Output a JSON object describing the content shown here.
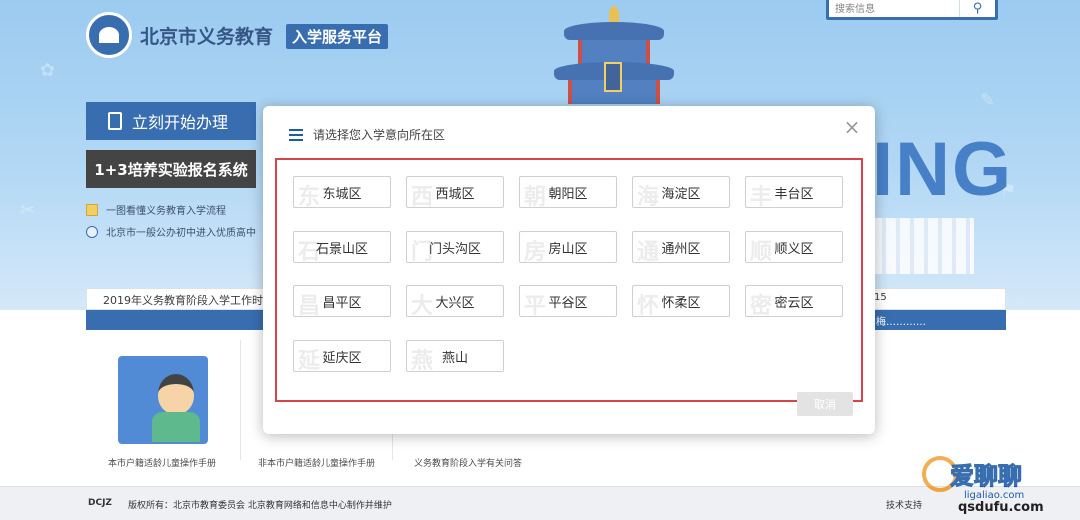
{
  "header": {
    "site_title": "北京市义务教育",
    "site_badge": "入学服务平台",
    "search_placeholder": "搜索信息"
  },
  "hero": {
    "big_letters": "ING",
    "temple_plaque": "祈年殿"
  },
  "left": {
    "start_label": "立刻开始办理",
    "reg_label": "1+3培养实验报名系统",
    "links": [
      "一图看懂义务教育入学流程",
      "北京市一般公办初中进入优质高中"
    ]
  },
  "news": {
    "text": "2019年义务教育阶段入学工作时间",
    "right_text": "15",
    "strip_text": "梅…………"
  },
  "cards": [
    {
      "caption": "本市户籍适龄儿童操作手册"
    },
    {
      "caption": "非本市户籍适龄儿童操作手册"
    },
    {
      "caption": "义务教育阶段入学有关问答"
    }
  ],
  "footer": {
    "logo": "DCJZ",
    "text": "版权所有：北京市教育委员会 北京教育网络和信息中心制作并维护",
    "right": "技术支持"
  },
  "watermark": {
    "text": "爱聊聊",
    "url": "ligaliao.com",
    "url2": "qsdufu.com"
  },
  "modal": {
    "title": "请选择您入学意向所在区",
    "cancel_label": "取消",
    "districts": [
      {
        "label": "东城区",
        "ghost": "东"
      },
      {
        "label": "西城区",
        "ghost": "西"
      },
      {
        "label": "朝阳区",
        "ghost": "朝"
      },
      {
        "label": "海淀区",
        "ghost": "海"
      },
      {
        "label": "丰台区",
        "ghost": "丰"
      },
      {
        "label": "石景山区",
        "ghost": "石"
      },
      {
        "label": "门头沟区",
        "ghost": "门"
      },
      {
        "label": "房山区",
        "ghost": "房"
      },
      {
        "label": "通州区",
        "ghost": "通"
      },
      {
        "label": "顺义区",
        "ghost": "顺"
      },
      {
        "label": "昌平区",
        "ghost": "昌"
      },
      {
        "label": "大兴区",
        "ghost": "大"
      },
      {
        "label": "平谷区",
        "ghost": "平"
      },
      {
        "label": "怀柔区",
        "ghost": "怀"
      },
      {
        "label": "密云区",
        "ghost": "密"
      },
      {
        "label": "延庆区",
        "ghost": "延"
      },
      {
        "label": "燕山",
        "ghost": "燕"
      }
    ]
  },
  "colors": {
    "brand_blue": "#1d5ba4",
    "frame_red": "#d9434a"
  }
}
